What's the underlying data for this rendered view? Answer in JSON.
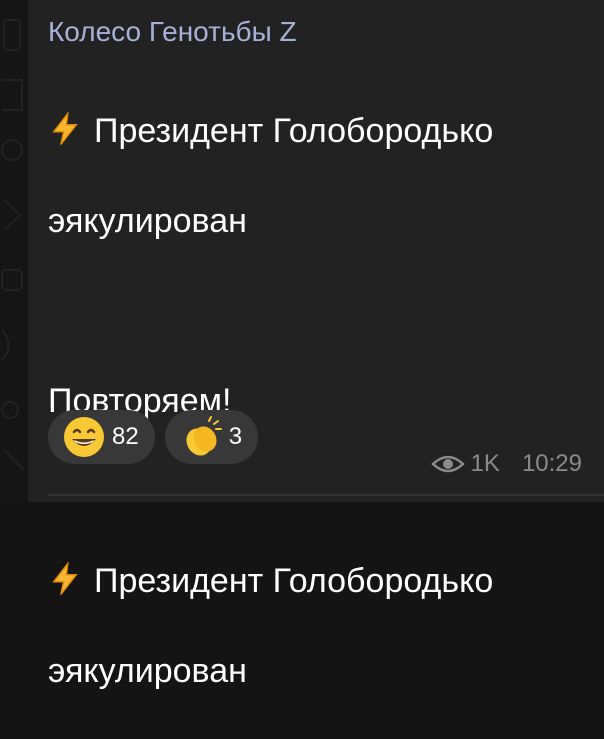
{
  "post": {
    "channel_name": "Колесо Генотьбы Z",
    "lines": [
      "Президент Голобородько",
      "эякулирован",
      "",
      "Повторяем!",
      "",
      "Президент Голобородько",
      "эякулирован"
    ],
    "reactions": [
      {
        "emoji": "grinning-face",
        "count": "82"
      },
      {
        "emoji": "clapping-hands",
        "count": "3"
      }
    ],
    "views": "1K",
    "time": "10:29"
  },
  "colors": {
    "channel_name": "#a7b1d8",
    "bubble": "#222222",
    "reaction_bg": "#383838",
    "meta": "#8a8a8a"
  }
}
